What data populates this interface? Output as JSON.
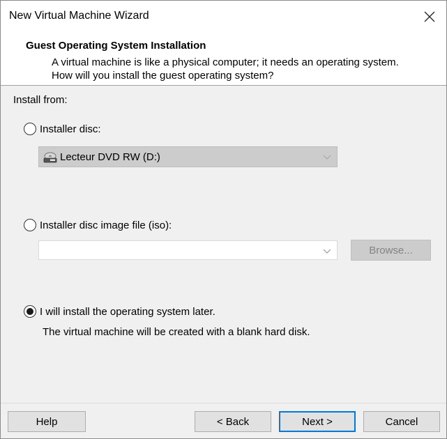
{
  "window": {
    "title": "New Virtual Machine Wizard"
  },
  "header": {
    "title": "Guest Operating System Installation",
    "description": "A virtual machine is like a physical computer; it needs an operating system. How will you install the guest operating system?"
  },
  "install_from": {
    "label": "Install from:",
    "options": [
      {
        "label": "Installer disc:",
        "selected": false
      },
      {
        "label": "Installer disc image file (iso):",
        "selected": false
      },
      {
        "label": "I will install the operating system later.",
        "selected": true
      }
    ],
    "disc_select_value": "Lecteur DVD RW (D:)",
    "iso_path_value": "",
    "browse_label": "Browse...",
    "later_info": "The virtual machine will be created with a blank hard disk."
  },
  "footer": {
    "help_label": "Help",
    "back_label": "< Back",
    "next_label": "Next >",
    "cancel_label": "Cancel"
  },
  "icons": {
    "close": "close-icon",
    "dvd_drive": "dvd-drive-icon",
    "dropdown": "chevron-down-icon"
  }
}
